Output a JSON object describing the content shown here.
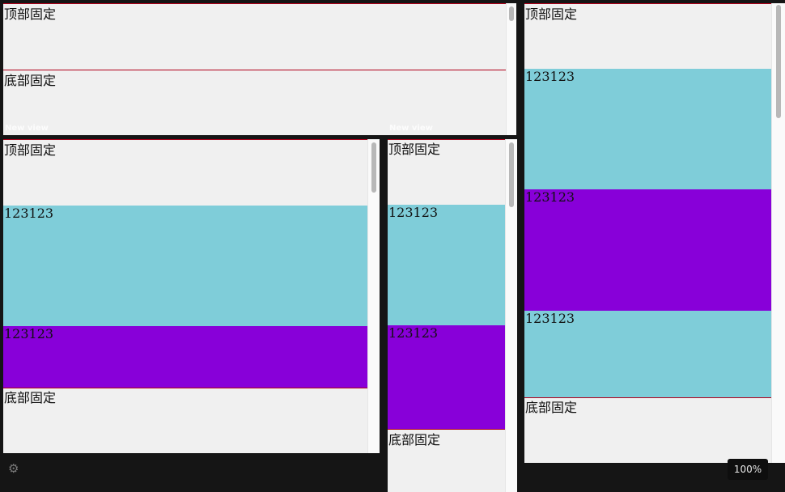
{
  "top_label": "顶部固定",
  "bottom_label": "底部固定",
  "row_label": "123123",
  "view_title": "New view",
  "zoom_level": "100%",
  "colors": {
    "background": "#151515",
    "panel": "#f0f0f0",
    "cyan": "#7fcdd9",
    "purple": "#8800d9",
    "divider": "#b0001a"
  },
  "icons": [
    "gear-icon"
  ]
}
